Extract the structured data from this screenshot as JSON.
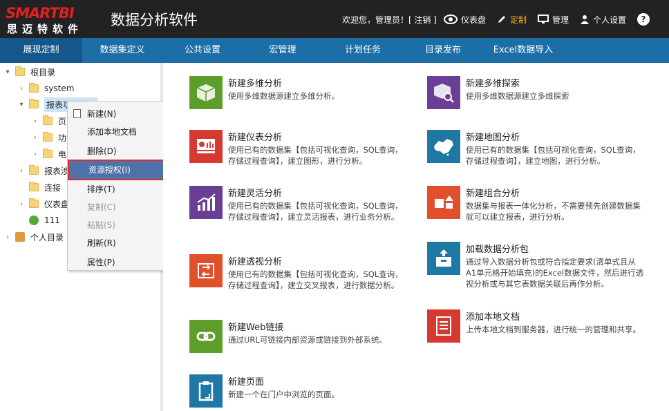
{
  "header": {
    "logo_top": "SMARTBI",
    "logo_bottom": "思迈特软件",
    "app_title": "数据分析软件",
    "welcome": "欢迎您，管理员！[ 注销 ]",
    "nav": [
      {
        "label": "仪表盘",
        "icon": "eye-icon"
      },
      {
        "label": "定制",
        "icon": "pencil-icon",
        "active": true
      },
      {
        "label": "管理",
        "icon": "monitor-icon"
      },
      {
        "label": "个人设置",
        "icon": "user-icon"
      }
    ],
    "help": "?"
  },
  "menubar": {
    "tabs": [
      "展现定制",
      "数据集定义",
      "公共设置",
      "宏管理",
      "计划任务",
      "目录发布",
      "Excel数据导入"
    ]
  },
  "tree": {
    "items": [
      {
        "label": "根目录"
      },
      {
        "label": "system"
      },
      {
        "label": "报表功能演示"
      },
      {
        "label": "页"
      },
      {
        "label": "功"
      },
      {
        "label": "电"
      },
      {
        "label": "报表涉"
      },
      {
        "label": "连接"
      },
      {
        "label": "仪表盘"
      },
      {
        "label": "111"
      },
      {
        "label": "个人目录"
      }
    ]
  },
  "context_menu": {
    "items": [
      {
        "label": "新建(N)"
      },
      {
        "label": "添加本地文档"
      },
      {
        "label": "删除(D)"
      },
      {
        "label": "资源授权(I)"
      },
      {
        "label": "排序(T)"
      },
      {
        "label": "复制(C)"
      },
      {
        "label": "粘贴(S)"
      },
      {
        "label": "刷新(R)"
      },
      {
        "label": "属性(P)"
      }
    ]
  },
  "cards": [
    {
      "title": "新建多维分析",
      "desc": "使用多维数据源建立多维分析。",
      "color": "#5d9e2a",
      "icon": "cube-icon"
    },
    {
      "title": "新建多维探索",
      "desc": "使用多维数据源建立多维探索",
      "color": "#6a3e95",
      "icon": "cube-search-icon"
    },
    {
      "title": "新建仪表分析",
      "desc": "使用已有的数据集【包括可视化查询，SQL查询，存储过程查询】，建立图形，进行分析。",
      "color": "#d5392f",
      "icon": "dashboard-chart-icon"
    },
    {
      "title": "新建地图分析",
      "desc": "使用已有的数据集【包括可视化查询，SQL查询，存储过程查询】，建立地图，进行分析。",
      "color": "#1f77a3",
      "icon": "china-map-icon"
    },
    {
      "title": "新建灵活分析",
      "desc": "使用已有的数据集【包括可视化查询，SQL查询，存储过程查询】，建立灵活报表，进行业务分析。",
      "color": "#6a3e95",
      "icon": "bar-chart-icon"
    },
    {
      "title": "新建组合分析",
      "desc": "数据集与报表一体化分析，不需要预先创建数据集就可以建立报表，进行分析。",
      "color": "#e0502a",
      "icon": "shapes-icon"
    },
    {
      "title": "加载数据分析包",
      "desc": "通过导入数据分析包或符合指定要求(清单式且从A1单元格开始填充)的Excel数据文件，然后进行透视分析或与其它表数据关联后再作分析。",
      "color": "#1f77a3",
      "icon": "package-upload-icon"
    },
    {
      "title": "新建透视分析",
      "desc": "使用已有的数据集【包括可视化查询，SQL查询，存储过程查询】，建立交叉报表，进行数据分析。",
      "color": "#e0502a",
      "icon": "pivot-icon"
    },
    {
      "title": "添加本地文档",
      "desc": "上传本地文档到服务器，进行统一的管理和共享。",
      "color": "#d5392f",
      "icon": "document-icon"
    },
    {
      "title": "新建Web链接",
      "desc": "通过URL可链接内部资源或链接到外部系统。",
      "color": "#5d9e2a",
      "icon": "link-icon"
    },
    {
      "title": "新建页面",
      "desc": "新建一个在门户中浏览的页面。",
      "color": "#1f77a3",
      "icon": "page-icon"
    }
  ]
}
